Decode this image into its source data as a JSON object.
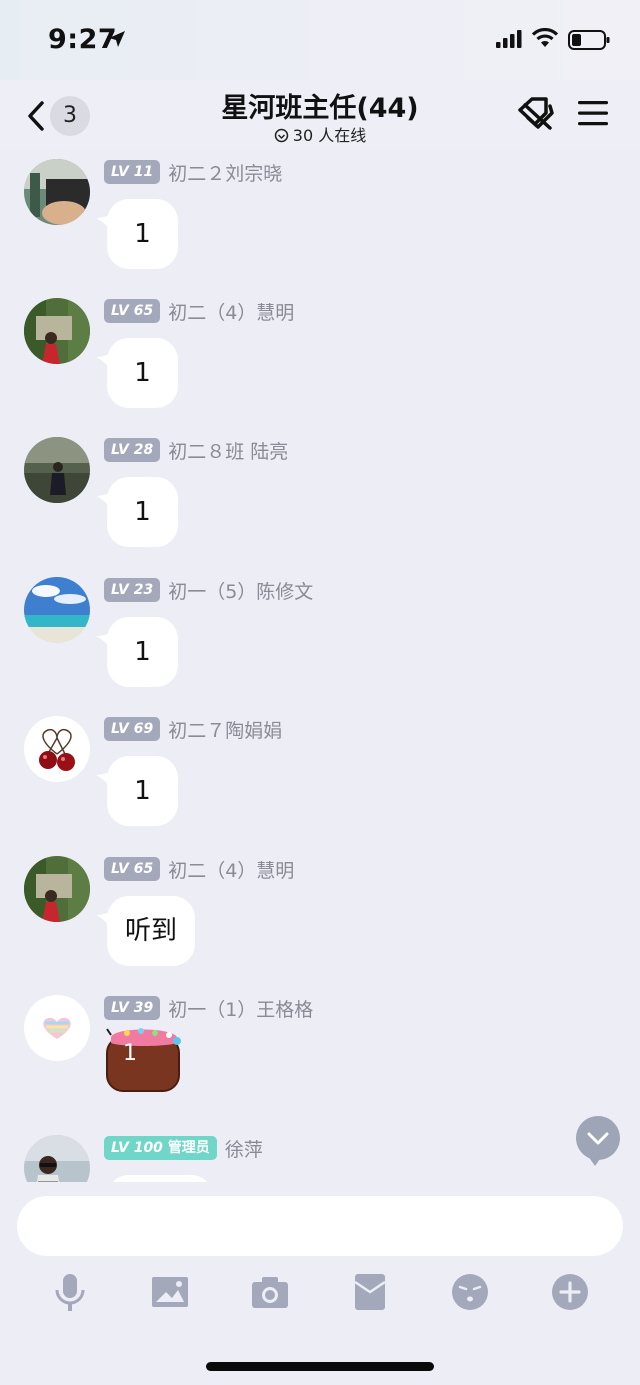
{
  "status_bar": {
    "time": "9:27"
  },
  "header": {
    "back_count": "3",
    "title": "星河班主任(44)",
    "online_text": "30 人在线"
  },
  "messages": [
    {
      "level": "LV 11",
      "sender": "初二２刘宗晓",
      "text": "1"
    },
    {
      "level": "LV 65",
      "sender": "初二（4）慧明",
      "text": "1"
    },
    {
      "level": "LV 28",
      "sender": "初二８班 陆亮",
      "text": "1"
    },
    {
      "level": "LV 23",
      "sender": "初一（5）陈修文",
      "text": "1"
    },
    {
      "level": "LV 69",
      "sender": "初二７陶娟娟",
      "text": "1"
    },
    {
      "level": "LV 65",
      "sender": "初二（4）慧明",
      "text": "听到"
    },
    {
      "level": "LV 39",
      "sender": "初一（1）王格格",
      "sticker_text": "1"
    },
    {
      "level": "LV 100",
      "role": "管理员",
      "sender": "徐萍"
    }
  ],
  "input": {
    "placeholder": ""
  },
  "toolbar": {
    "icons": [
      "microphone-icon",
      "image-icon",
      "camera-icon",
      "red-packet-icon",
      "emoji-icon",
      "plus-icon"
    ]
  },
  "colors": {
    "background": "#ecedf5",
    "level_badge": "#a3a8ba",
    "admin_badge": "#6fd6c8",
    "toolbar_icon": "#a3a8ba"
  }
}
